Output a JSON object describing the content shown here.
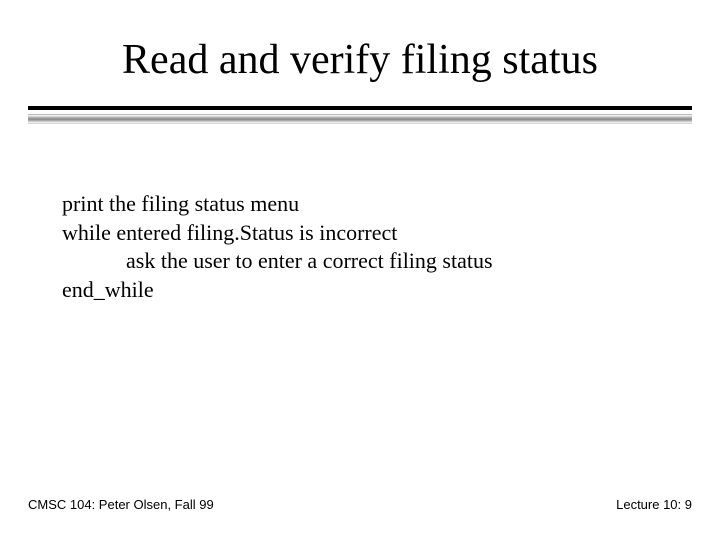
{
  "title": "Read and verify filing status",
  "pseudo": {
    "l1": "print the filing status menu",
    "l2": "while entered filing.Status is incorrect",
    "l3": "ask the user to enter a correct filing status",
    "l4": "end_while"
  },
  "footer": {
    "left": "CMSC 104: Peter Olsen, Fall 99",
    "right": "Lecture 10: 9"
  }
}
